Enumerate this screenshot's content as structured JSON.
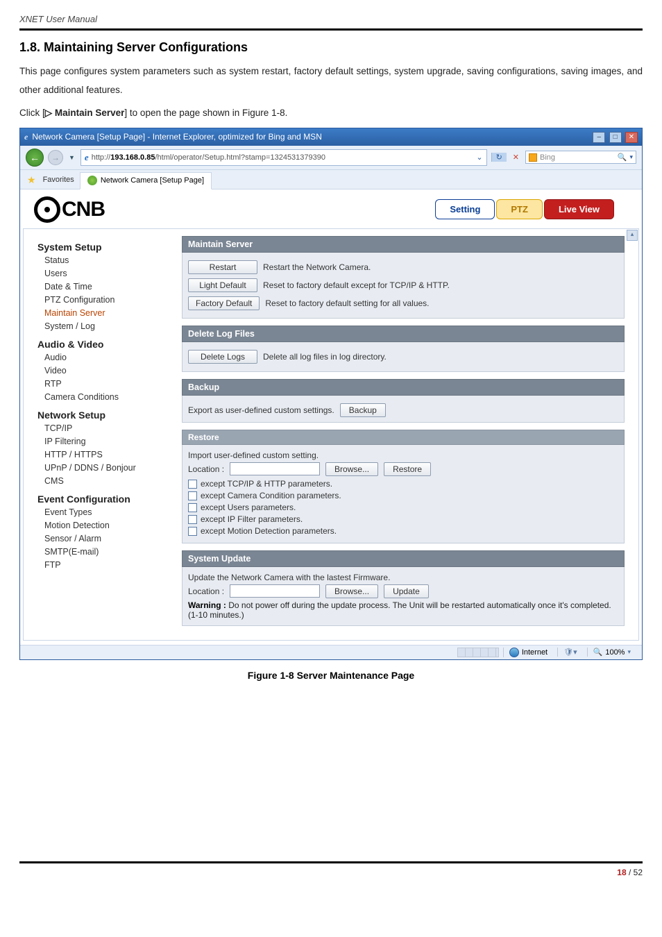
{
  "doc": {
    "header": "XNET User Manual",
    "section_number": "1.8. Maintaining Server Configurations",
    "para1": "This page configures system parameters such as system restart, factory default settings, system upgrade, saving configurations, saving images, and other additional features.",
    "para2_prefix": "Click [",
    "para2_bold": "▷ Maintain Server",
    "para2_suffix": "] to open the page shown in Figure 1-8.",
    "fig_caption": "Figure 1-8 Server Maintenance Page",
    "page_current": "18",
    "page_sep": " / ",
    "page_total": "52"
  },
  "ie": {
    "title": "Network Camera [Setup Page] - Internet Explorer, optimized for Bing and MSN",
    "url_host": "193.168.0.85",
    "url_prefix": "http://",
    "url_path": "/html/operator/Setup.html?stamp=1324531379390",
    "search_placeholder": "Bing",
    "fav_label": "Favorites",
    "tab_title": "Network Camera [Setup Page]",
    "status_zone": "Internet",
    "status_zoom": "100%"
  },
  "cam": {
    "logo_text": "CNB",
    "btn_setting": "Setting",
    "btn_ptz": "PTZ",
    "btn_live": "Live View",
    "sidebar": {
      "g1": "System Setup",
      "g1_items": [
        "Status",
        "Users",
        "Date & Time",
        "PTZ Configuration",
        "Maintain Server",
        "System / Log"
      ],
      "g2": "Audio & Video",
      "g2_items": [
        "Audio",
        "Video",
        "RTP",
        "Camera Conditions"
      ],
      "g3": "Network Setup",
      "g3_items": [
        "TCP/IP",
        "IP Filtering",
        "HTTP / HTTPS",
        "UPnP / DDNS / Bonjour",
        "CMS"
      ],
      "g4": "Event Configuration",
      "g4_items": [
        "Event Types",
        "Motion Detection",
        "Sensor / Alarm",
        "SMTP(E-mail)",
        "FTP"
      ]
    },
    "sections": {
      "maintain_hd": "Maintain Server",
      "restart_btn": "Restart",
      "restart_desc": "Restart the Network Camera.",
      "light_btn": "Light Default",
      "light_desc": "Reset to factory default except for TCP/IP & HTTP.",
      "fact_btn": "Factory Default",
      "fact_desc": "Reset to factory default setting for all values.",
      "dellog_hd": "Delete Log Files",
      "dellog_btn": "Delete Logs",
      "dellog_desc": "Delete all log files in log directory.",
      "backup_hd": "Backup",
      "backup_desc": "Export as user-defined custom settings.",
      "backup_btn": "Backup",
      "restore_hd": "Restore",
      "restore_desc": "Import user-defined custom setting.",
      "restore_loc": "Location :",
      "browse_btn": "Browse...",
      "restore_btn": "Restore",
      "restore_chk1": "except TCP/IP & HTTP parameters.",
      "restore_chk2": "except Camera Condition parameters.",
      "restore_chk3": "except Users parameters.",
      "restore_chk4": "except IP Filter parameters.",
      "restore_chk5": "except Motion Detection parameters.",
      "update_hd": "System Update",
      "update_desc": "Update the Network Camera with the lastest Firmware.",
      "update_loc": "Location :",
      "update_btn": "Update",
      "update_warn_b": "Warning :",
      "update_warn": " Do not power off during the update process. The Unit will be restarted automatically once it's completed. (1-10 minutes.)"
    }
  }
}
